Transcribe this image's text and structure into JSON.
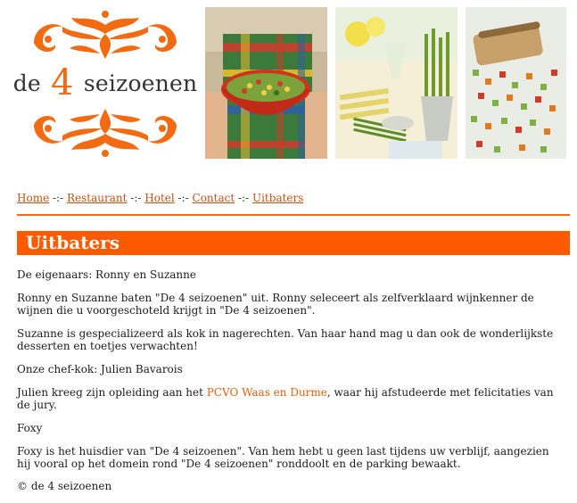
{
  "brand": {
    "prefix": "de",
    "number": "4",
    "suffix": "seizoenen"
  },
  "nav": {
    "items": [
      {
        "label": "Home"
      },
      {
        "label": "Restaurant"
      },
      {
        "label": "Hotel"
      },
      {
        "label": "Contact"
      },
      {
        "label": "Uitbaters"
      }
    ],
    "separator": "-:-"
  },
  "page": {
    "title": "Uitbaters"
  },
  "content": {
    "p1": "De eigenaars: Ronny en Suzanne",
    "p2": "Ronny en Suzanne baten \"De 4 seizoenen\" uit. Ronny seleceert als zelfverklaard wijnkenner de wijnen die u voorgeschoteld krijgt in \"De 4 seizoenen\".",
    "p3": "Suzanne is gespecializeerd als kok in nagerechten. Van haar hand mag u dan ook de wonderlijkste desserten en toetjes verwachten!",
    "p4": "Onze chef-kok: Julien Bavarois",
    "p5_before": "Julien kreeg zijn opleiding aan het ",
    "p5_link": "PCVO Waas en Durme",
    "p5_after": ", waar hij afstudeerde met felicitaties van de jury.",
    "p6": "Foxy",
    "p7": "Foxy is het huisdier van \"De 4 seizoenen\". Van hem hebt u geen last tijdens uw verblijf, aangezien hij vooral op het domein rond \"De 4 seizoenen\" ronddoolt en de parking bewaakt.",
    "copyright": "© de 4 seizoenen"
  },
  "colors": {
    "accent": "#ff5a00",
    "link": "#c25212",
    "ornament": "#f26a12"
  },
  "icons": [
    "ornament-top-icon",
    "ornament-bottom-icon"
  ]
}
